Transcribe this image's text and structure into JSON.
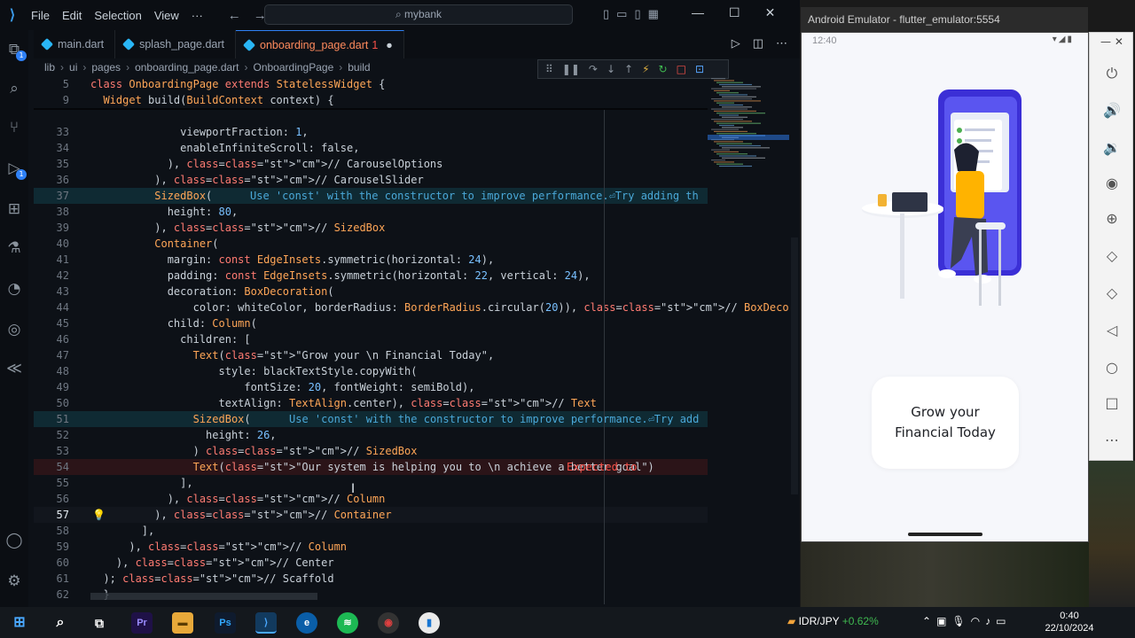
{
  "vscode": {
    "menu": [
      "File",
      "Edit",
      "Selection",
      "View",
      "···"
    ],
    "search_text": "mybank",
    "tabs": [
      {
        "label": "main.dart",
        "active": false
      },
      {
        "label": "splash_page.dart",
        "active": false
      },
      {
        "label": "onboarding_page.dart",
        "active": true,
        "errors": "1",
        "dirty": "●"
      }
    ],
    "breadcrumb": [
      "lib",
      "ui",
      "pages",
      "onboarding_page.dart",
      "OnboardingPage",
      "build"
    ],
    "code": {
      "lines": [
        {
          "n": "5",
          "t": "class OnboardingPage extends StatelessWidget {"
        },
        {
          "n": "9",
          "t": "  Widget build(BuildContext context) {"
        },
        {
          "n": "33",
          "t": "              viewportFraction: 1,"
        },
        {
          "n": "34",
          "t": "              enableInfiniteScroll: false,"
        },
        {
          "n": "35",
          "t": "            ), // CarouselOptions"
        },
        {
          "n": "36",
          "t": "          ), // CarouselSlider"
        },
        {
          "n": "37",
          "t": "          SizedBox(",
          "diag": "Use 'const' with the constructor to improve performance.⏎Try adding th"
        },
        {
          "n": "38",
          "t": "            height: 80,"
        },
        {
          "n": "39",
          "t": "          ), // SizedBox"
        },
        {
          "n": "40",
          "t": "          Container("
        },
        {
          "n": "41",
          "t": "            margin: const EdgeInsets.symmetric(horizontal: 24),"
        },
        {
          "n": "42",
          "t": "            padding: const EdgeInsets.symmetric(horizontal: 22, vertical: 24),"
        },
        {
          "n": "43",
          "t": "            decoration: BoxDecoration("
        },
        {
          "n": "44",
          "t": "                color: whiteColor, borderRadius: BorderRadius.circular(20)), // BoxDecoration"
        },
        {
          "n": "45",
          "t": "            child: Column("
        },
        {
          "n": "46",
          "t": "              children: ["
        },
        {
          "n": "47",
          "t": "                Text(\"Grow your \\n Financial Today\","
        },
        {
          "n": "48",
          "t": "                    style: blackTextStyle.copyWith("
        },
        {
          "n": "49",
          "t": "                        fontSize: 20, fontWeight: semiBold),"
        },
        {
          "n": "50",
          "t": "                    textAlign: TextAlign.center), // Text"
        },
        {
          "n": "51",
          "t": "                SizedBox(",
          "diag": "Use 'const' with the constructor to improve performance.⏎Try add"
        },
        {
          "n": "52",
          "t": "                  height: 26,"
        },
        {
          "n": "53",
          "t": "                ) // SizedBox"
        },
        {
          "n": "54",
          "t": "                Text(\"Our system is helping you to \\n achieve a better goal\")",
          "diag": "Expected to "
        },
        {
          "n": "55",
          "t": "              ],"
        },
        {
          "n": "56",
          "t": "            ), // Column"
        },
        {
          "n": "57",
          "t": "          ), // Container"
        },
        {
          "n": "58",
          "t": "        ],"
        },
        {
          "n": "59",
          "t": "      ), // Column"
        },
        {
          "n": "60",
          "t": "    ), // Center"
        },
        {
          "n": "61",
          "t": "  ); // Scaffold"
        },
        {
          "n": "62",
          "t": "  }"
        }
      ]
    }
  },
  "emulator": {
    "window_title": "Android Emulator - flutter_emulator:5554",
    "status_time": "12:40",
    "card_text": "Grow your\nFinancial Today"
  },
  "taskbar": {
    "ticker_pair": "IDR/JPY",
    "ticker_change": "+0.62%",
    "clock_time": "0:40",
    "clock_date": "22/10/2024"
  }
}
